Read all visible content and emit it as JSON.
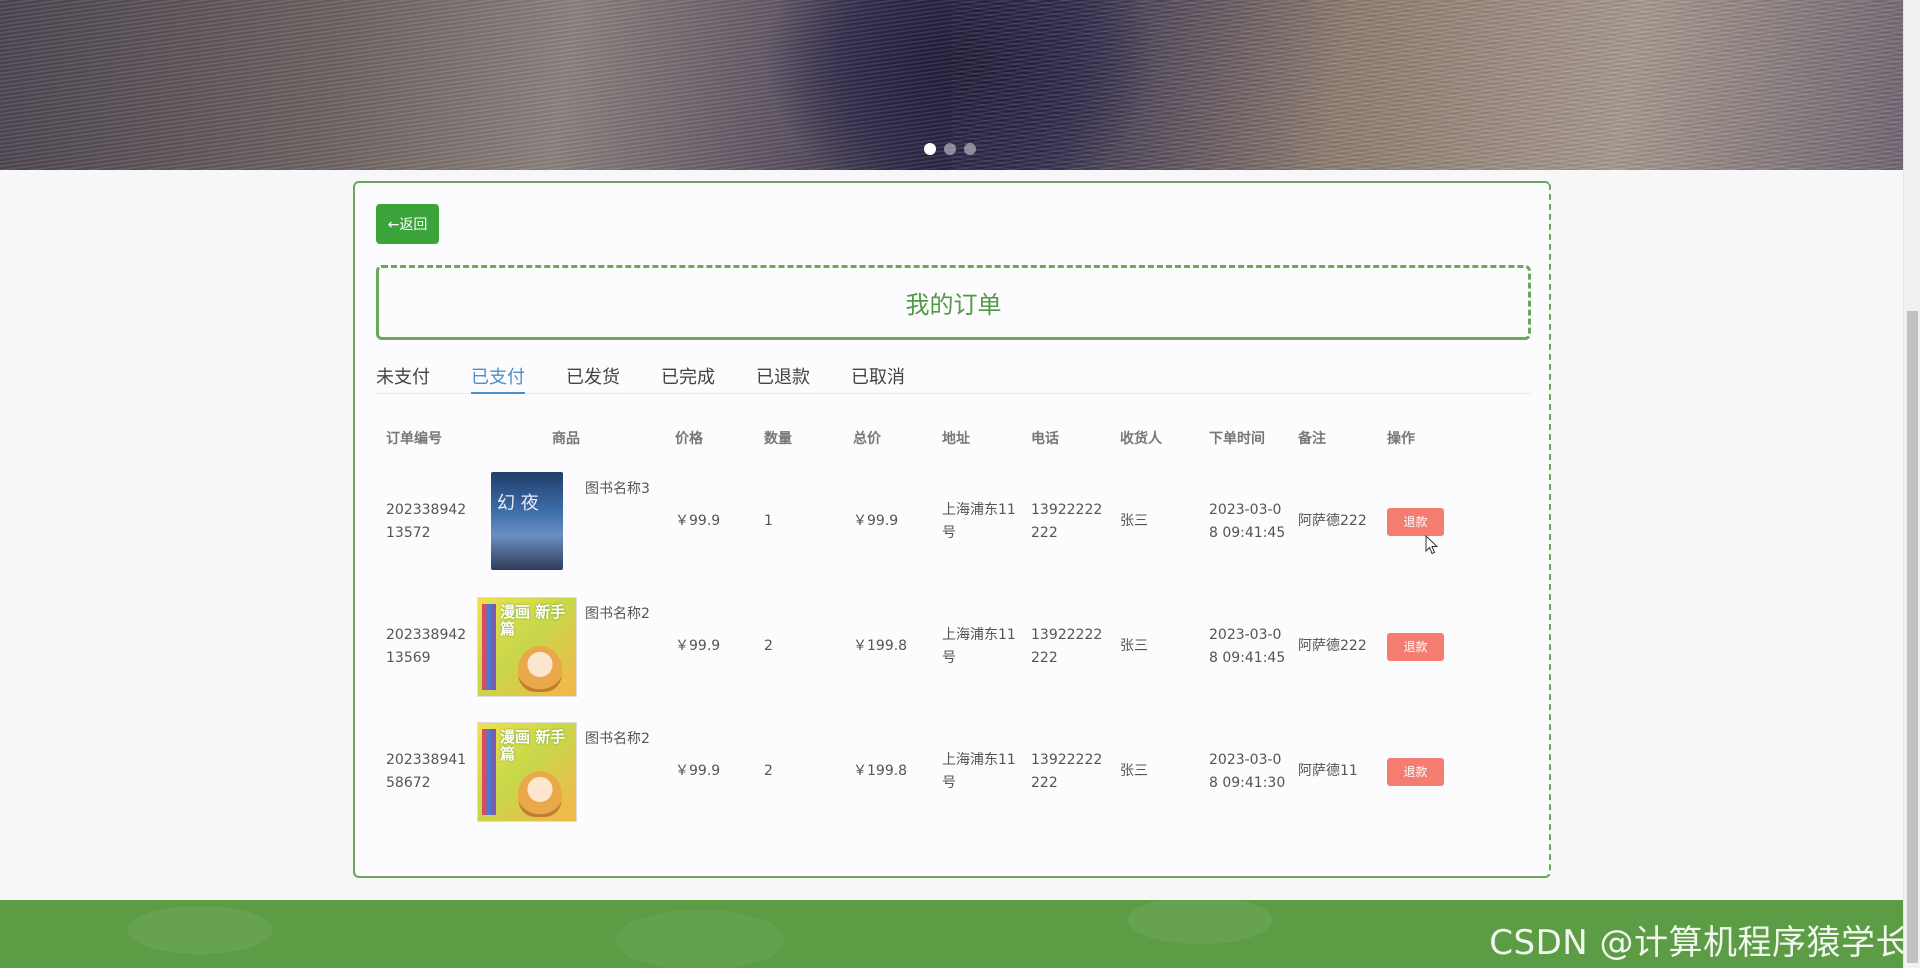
{
  "banner": {
    "slides": 3,
    "active_slide": 1
  },
  "back_button": "←返回",
  "page_title": "我的订单",
  "tabs": [
    {
      "label": "未支付",
      "active": false
    },
    {
      "label": "已支付",
      "active": true
    },
    {
      "label": "已发货",
      "active": false
    },
    {
      "label": "已完成",
      "active": false
    },
    {
      "label": "已退款",
      "active": false
    },
    {
      "label": "已取消",
      "active": false
    }
  ],
  "table": {
    "headers": [
      "订单编号",
      "商品",
      "价格",
      "数量",
      "总价",
      "地址",
      "电话",
      "收货人",
      "下单时间",
      "备注",
      "操作"
    ],
    "rows": [
      {
        "id": "20233894213572",
        "goods_name": "图书名称3",
        "cover_text": "幻 夜",
        "cover": "dark",
        "price": "￥99.9",
        "qty": "1",
        "total": "￥99.9",
        "address": "上海浦东11号",
        "phone": "13922222222",
        "receiver": "张三",
        "time": "2023-03-08 09:41:45",
        "note": "阿萨德222",
        "action": "退款"
      },
      {
        "id": "20233894213569",
        "goods_name": "图书名称2",
        "cover_text": "漫画 新手篇",
        "cover": "yellow",
        "price": "￥99.9",
        "qty": "2",
        "total": "￥199.8",
        "address": "上海浦东11号",
        "phone": "13922222222",
        "receiver": "张三",
        "time": "2023-03-08 09:41:45",
        "note": "阿萨德222",
        "action": "退款"
      },
      {
        "id": "20233894158672",
        "goods_name": "图书名称2",
        "cover_text": "漫画 新手篇",
        "cover": "yellow",
        "price": "￥99.9",
        "qty": "2",
        "total": "￥199.8",
        "address": "上海浦东11号",
        "phone": "13922222222",
        "receiver": "张三",
        "time": "2023-03-08 09:41:30",
        "note": "阿萨德11",
        "action": "退款"
      }
    ]
  },
  "watermark": "CSDN @计算机程序猿学长",
  "colors": {
    "accent_green": "#3aa33a",
    "title_green": "#4f9a45",
    "active_tab": "#4a90c8",
    "refund_button": "#f47c70",
    "footer": "#5c9c44"
  }
}
